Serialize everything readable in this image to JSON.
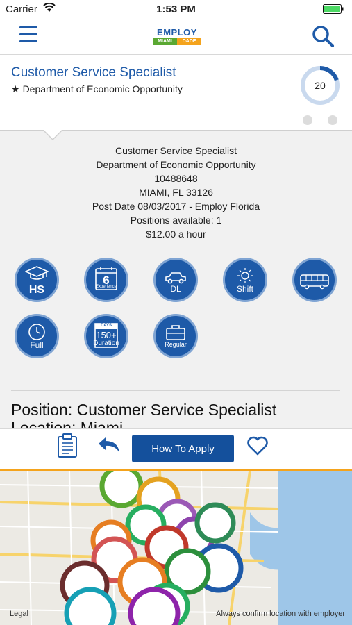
{
  "status_bar": {
    "carrier": "Carrier",
    "time": "1:53 PM"
  },
  "header": {
    "logo_top": "EMPLOY",
    "logo_left": "MIAMI",
    "logo_right": "DADE"
  },
  "job": {
    "title": "Customer Service Specialist",
    "department": "Department of Economic Opportunity",
    "score": "20",
    "score_fraction": 0.2
  },
  "details": {
    "lines": [
      "Customer Service Specialist",
      "Department of Economic Opportunity",
      "10488648",
      "MIAMI, FL 33126",
      "Post Date 08/03/2017 - Employ Florida",
      "Positions available: 1",
      "$12.00 a hour"
    ],
    "badges": [
      {
        "icon": "graduation-cap-icon",
        "label": "HS"
      },
      {
        "icon": "calendar-icon",
        "value": "6",
        "label": "Experience"
      },
      {
        "icon": "car-icon",
        "label": "DL"
      },
      {
        "icon": "sun-icon",
        "label": "Shift"
      },
      {
        "icon": "bus-icon",
        "label": ""
      },
      {
        "icon": "clock-icon",
        "label": "Full"
      },
      {
        "icon": "duration-calendar-icon",
        "top": "DAYS",
        "value": "150+",
        "label": "Duration"
      },
      {
        "icon": "briefcase-icon",
        "label": "Regular"
      }
    ],
    "position_text": "Position: Customer Service Specialist",
    "location_text": "Location: Miami"
  },
  "action_bar": {
    "apply_label": "How To Apply"
  },
  "map": {
    "legal_label": "Legal",
    "disclaimer": "Always confirm location with employer"
  },
  "colors": {
    "brand_blue": "#1e5aa8",
    "accent_orange": "#f4a31c",
    "logo_green": "#5aa832"
  }
}
